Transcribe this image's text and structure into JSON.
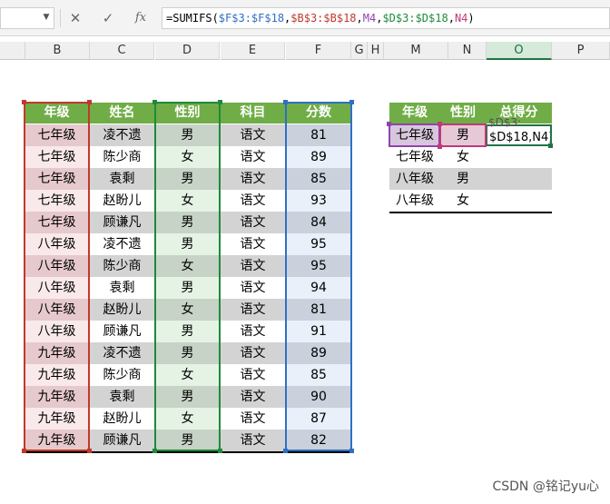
{
  "formula_bar": {
    "name_box": "",
    "cancel_icon": "cancel-x-icon",
    "enter_icon": "enter-check-icon",
    "fx_label": "fx",
    "formula_parts": [
      {
        "text": "=SUMIFS(",
        "color": "#000000"
      },
      {
        "text": "$F$3:$F$18",
        "color": "#2f6fc4"
      },
      {
        "text": ",",
        "color": "#000000"
      },
      {
        "text": "$B$3:$B$18",
        "color": "#c0392b"
      },
      {
        "text": ",",
        "color": "#000000"
      },
      {
        "text": "M4",
        "color": "#8e44ad"
      },
      {
        "text": ",",
        "color": "#000000"
      },
      {
        "text": "$D$3:$D$18",
        "color": "#1e8a3b"
      },
      {
        "text": ",",
        "color": "#000000"
      },
      {
        "text": "N4",
        "color": "#c0397a"
      },
      {
        "text": ")",
        "color": "#000000"
      }
    ]
  },
  "column_headers": [
    "B",
    "C",
    "D",
    "E",
    "F",
    "G",
    "H",
    "M",
    "N",
    "O",
    "P"
  ],
  "selected_column": "O",
  "main_table": {
    "headers": [
      "年级",
      "姓名",
      "性别",
      "科目",
      "分数"
    ],
    "rows": [
      [
        "七年级",
        "凌不遗",
        "男",
        "语文",
        "81"
      ],
      [
        "七年级",
        "陈少商",
        "女",
        "语文",
        "89"
      ],
      [
        "七年级",
        "袁剩",
        "男",
        "语文",
        "85"
      ],
      [
        "七年级",
        "赵盼儿",
        "女",
        "语文",
        "93"
      ],
      [
        "七年级",
        "顾谦凡",
        "男",
        "语文",
        "84"
      ],
      [
        "八年级",
        "凌不遗",
        "男",
        "语文",
        "95"
      ],
      [
        "八年级",
        "陈少商",
        "女",
        "语文",
        "95"
      ],
      [
        "八年级",
        "袁剩",
        "男",
        "语文",
        "94"
      ],
      [
        "八年级",
        "赵盼儿",
        "女",
        "语文",
        "81"
      ],
      [
        "八年级",
        "顾谦凡",
        "男",
        "语文",
        "91"
      ],
      [
        "九年级",
        "凌不遗",
        "男",
        "语文",
        "89"
      ],
      [
        "九年级",
        "陈少商",
        "女",
        "语文",
        "85"
      ],
      [
        "九年级",
        "袁剩",
        "男",
        "语文",
        "90"
      ],
      [
        "九年级",
        "赵盼儿",
        "女",
        "语文",
        "87"
      ],
      [
        "九年级",
        "顾谦凡",
        "男",
        "语文",
        "82"
      ]
    ]
  },
  "summary_table": {
    "headers": [
      "年级",
      "性别",
      "总得分"
    ],
    "rows": [
      [
        "七年级",
        "男",
        "$D$18,N4)"
      ],
      [
        "七年级",
        "女",
        ""
      ],
      [
        "八年级",
        "男",
        ""
      ],
      [
        "八年级",
        "女",
        ""
      ]
    ],
    "edit_overflow_text": "$D$3:"
  },
  "colors": {
    "header_green": "#70ad47",
    "range_red": "#c0392b",
    "range_green": "#1e8a3b",
    "range_blue": "#2f6fc4",
    "ref_purple": "#8e44ad",
    "ref_pink": "#c0397a"
  },
  "watermark": "CSDN @铭记yu心"
}
